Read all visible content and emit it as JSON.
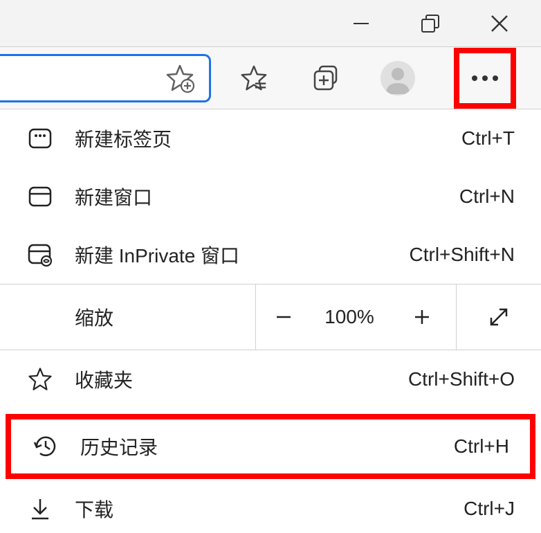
{
  "window": {
    "minimize": "minimize",
    "maximize": "maximize",
    "close": "close"
  },
  "toolbar": {
    "add_favorite": "add-favorite",
    "favorites": "favorites",
    "collections": "collections",
    "profile": "profile",
    "menu": "menu"
  },
  "menu": {
    "new_tab": {
      "label": "新建标签页",
      "shortcut": "Ctrl+T"
    },
    "new_window": {
      "label": "新建窗口",
      "shortcut": "Ctrl+N"
    },
    "new_inprivate": {
      "label": "新建 InPrivate 窗口",
      "shortcut": "Ctrl+Shift+N"
    },
    "zoom": {
      "label": "缩放",
      "value": "100%"
    },
    "favorites": {
      "label": "收藏夹",
      "shortcut": "Ctrl+Shift+O"
    },
    "history": {
      "label": "历史记录",
      "shortcut": "Ctrl+H"
    },
    "downloads": {
      "label": "下载",
      "shortcut": "Ctrl+J"
    }
  }
}
